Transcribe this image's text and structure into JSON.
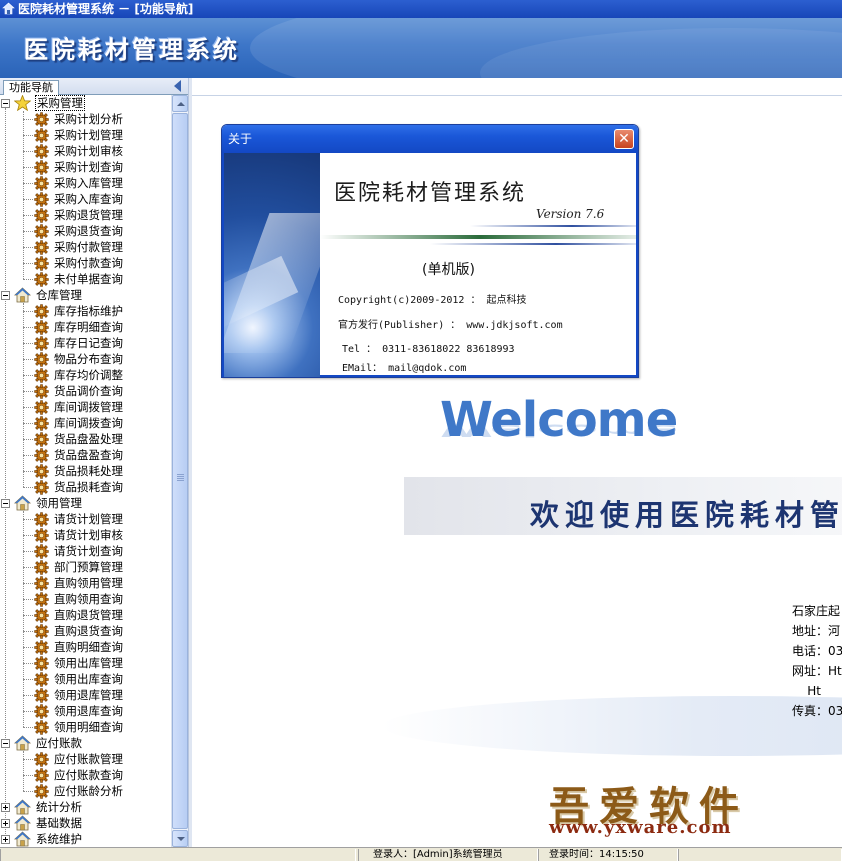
{
  "window": {
    "title": "医院耗材管理系统 － [功能导航]"
  },
  "banner": {
    "title": "医院耗材管理系统"
  },
  "nav": {
    "tab_label": "功能导航",
    "groups": [
      {
        "label": "采购管理",
        "icon": "star-icon",
        "expanded": true,
        "selected": true,
        "items": [
          "采购计划分析",
          "采购计划管理",
          "采购计划审核",
          "采购计划查询",
          "采购入库管理",
          "采购入库查询",
          "采购退货管理",
          "采购退货查询",
          "采购付款管理",
          "采购付款查询",
          "未付单据查询"
        ]
      },
      {
        "label": "仓库管理",
        "icon": "house-icon",
        "expanded": true,
        "items": [
          "库存指标维护",
          "库存明细查询",
          "库存日记查询",
          "物品分布查询",
          "库存均价调整",
          "货品调价查询",
          "库间调拨管理",
          "库间调拨查询",
          "货品盘盈处理",
          "货品盘盈查询",
          "货品损耗处理",
          "货品损耗查询"
        ]
      },
      {
        "label": "领用管理",
        "icon": "house-icon",
        "expanded": true,
        "items": [
          "请货计划管理",
          "请货计划审核",
          "请货计划查询",
          "部门预算管理",
          "直购领用管理",
          "直购领用查询",
          "直购退货管理",
          "直购退货查询",
          "直购明细查询",
          "领用出库管理",
          "领用出库查询",
          "领用退库管理",
          "领用退库查询",
          "领用明细查询"
        ]
      },
      {
        "label": "应付账款",
        "icon": "house-icon",
        "expanded": true,
        "items": [
          "应付账款管理",
          "应付账款查询",
          "应付账龄分析"
        ]
      },
      {
        "label": "统计分析",
        "icon": "house-icon",
        "expanded": false,
        "items": []
      },
      {
        "label": "基础数据",
        "icon": "house-icon",
        "expanded": false,
        "items": []
      },
      {
        "label": "系统维护",
        "icon": "house-icon",
        "expanded": false,
        "items": []
      }
    ]
  },
  "about": {
    "title": "关于",
    "product": "医院耗材管理系统",
    "version": "Version 7.6",
    "edition": "(单机版)",
    "copyright": "Copyright(c)2009-2012 ： 起点科技",
    "publisher": "官方发行(Publisher)   ： www.jdkjsoft.com",
    "tel": "Tel   ： 0311-83618022  83618993",
    "email": "EMail： mail@qdok.com"
  },
  "welcome": {
    "word": "Welcome",
    "text": "欢迎使用医院耗材管",
    "company_lines": [
      "石家庄起",
      "地址：河",
      "电话：03",
      "网址：Ht",
      "    Ht",
      "传真：03"
    ]
  },
  "watermark": {
    "text": "吾爱软件",
    "url": "www.yxware.com"
  },
  "status": {
    "login_user": "登录人：[Admin]系统管理员",
    "login_time": "登录时间：14:15:50"
  },
  "colors": {
    "titlebar": "#1746b8",
    "banner": "#3d76c8",
    "welcome_text": "#1d3571",
    "watermark": "#8c5a18"
  }
}
